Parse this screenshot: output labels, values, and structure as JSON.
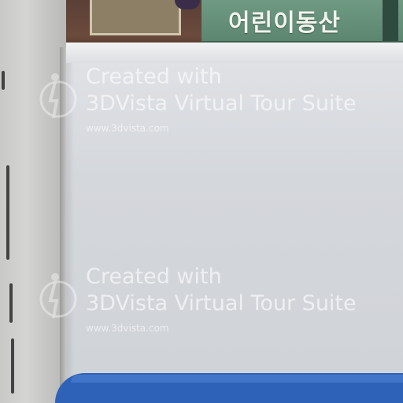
{
  "sign": {
    "text": "어린이동산"
  },
  "watermarks": [
    {
      "line1": "Created with",
      "line2": "3DVista Virtual Tour Suite",
      "url": "www.3dvista.com"
    },
    {
      "line1": "Created with",
      "line2": "3DVista Virtual Tour Suite",
      "url": "www.3dvista.com"
    }
  ],
  "colors": {
    "board": "#d4d7dc",
    "wood": "#5a4036",
    "sign": "#6f9a82",
    "tray": "#2d62b8"
  }
}
